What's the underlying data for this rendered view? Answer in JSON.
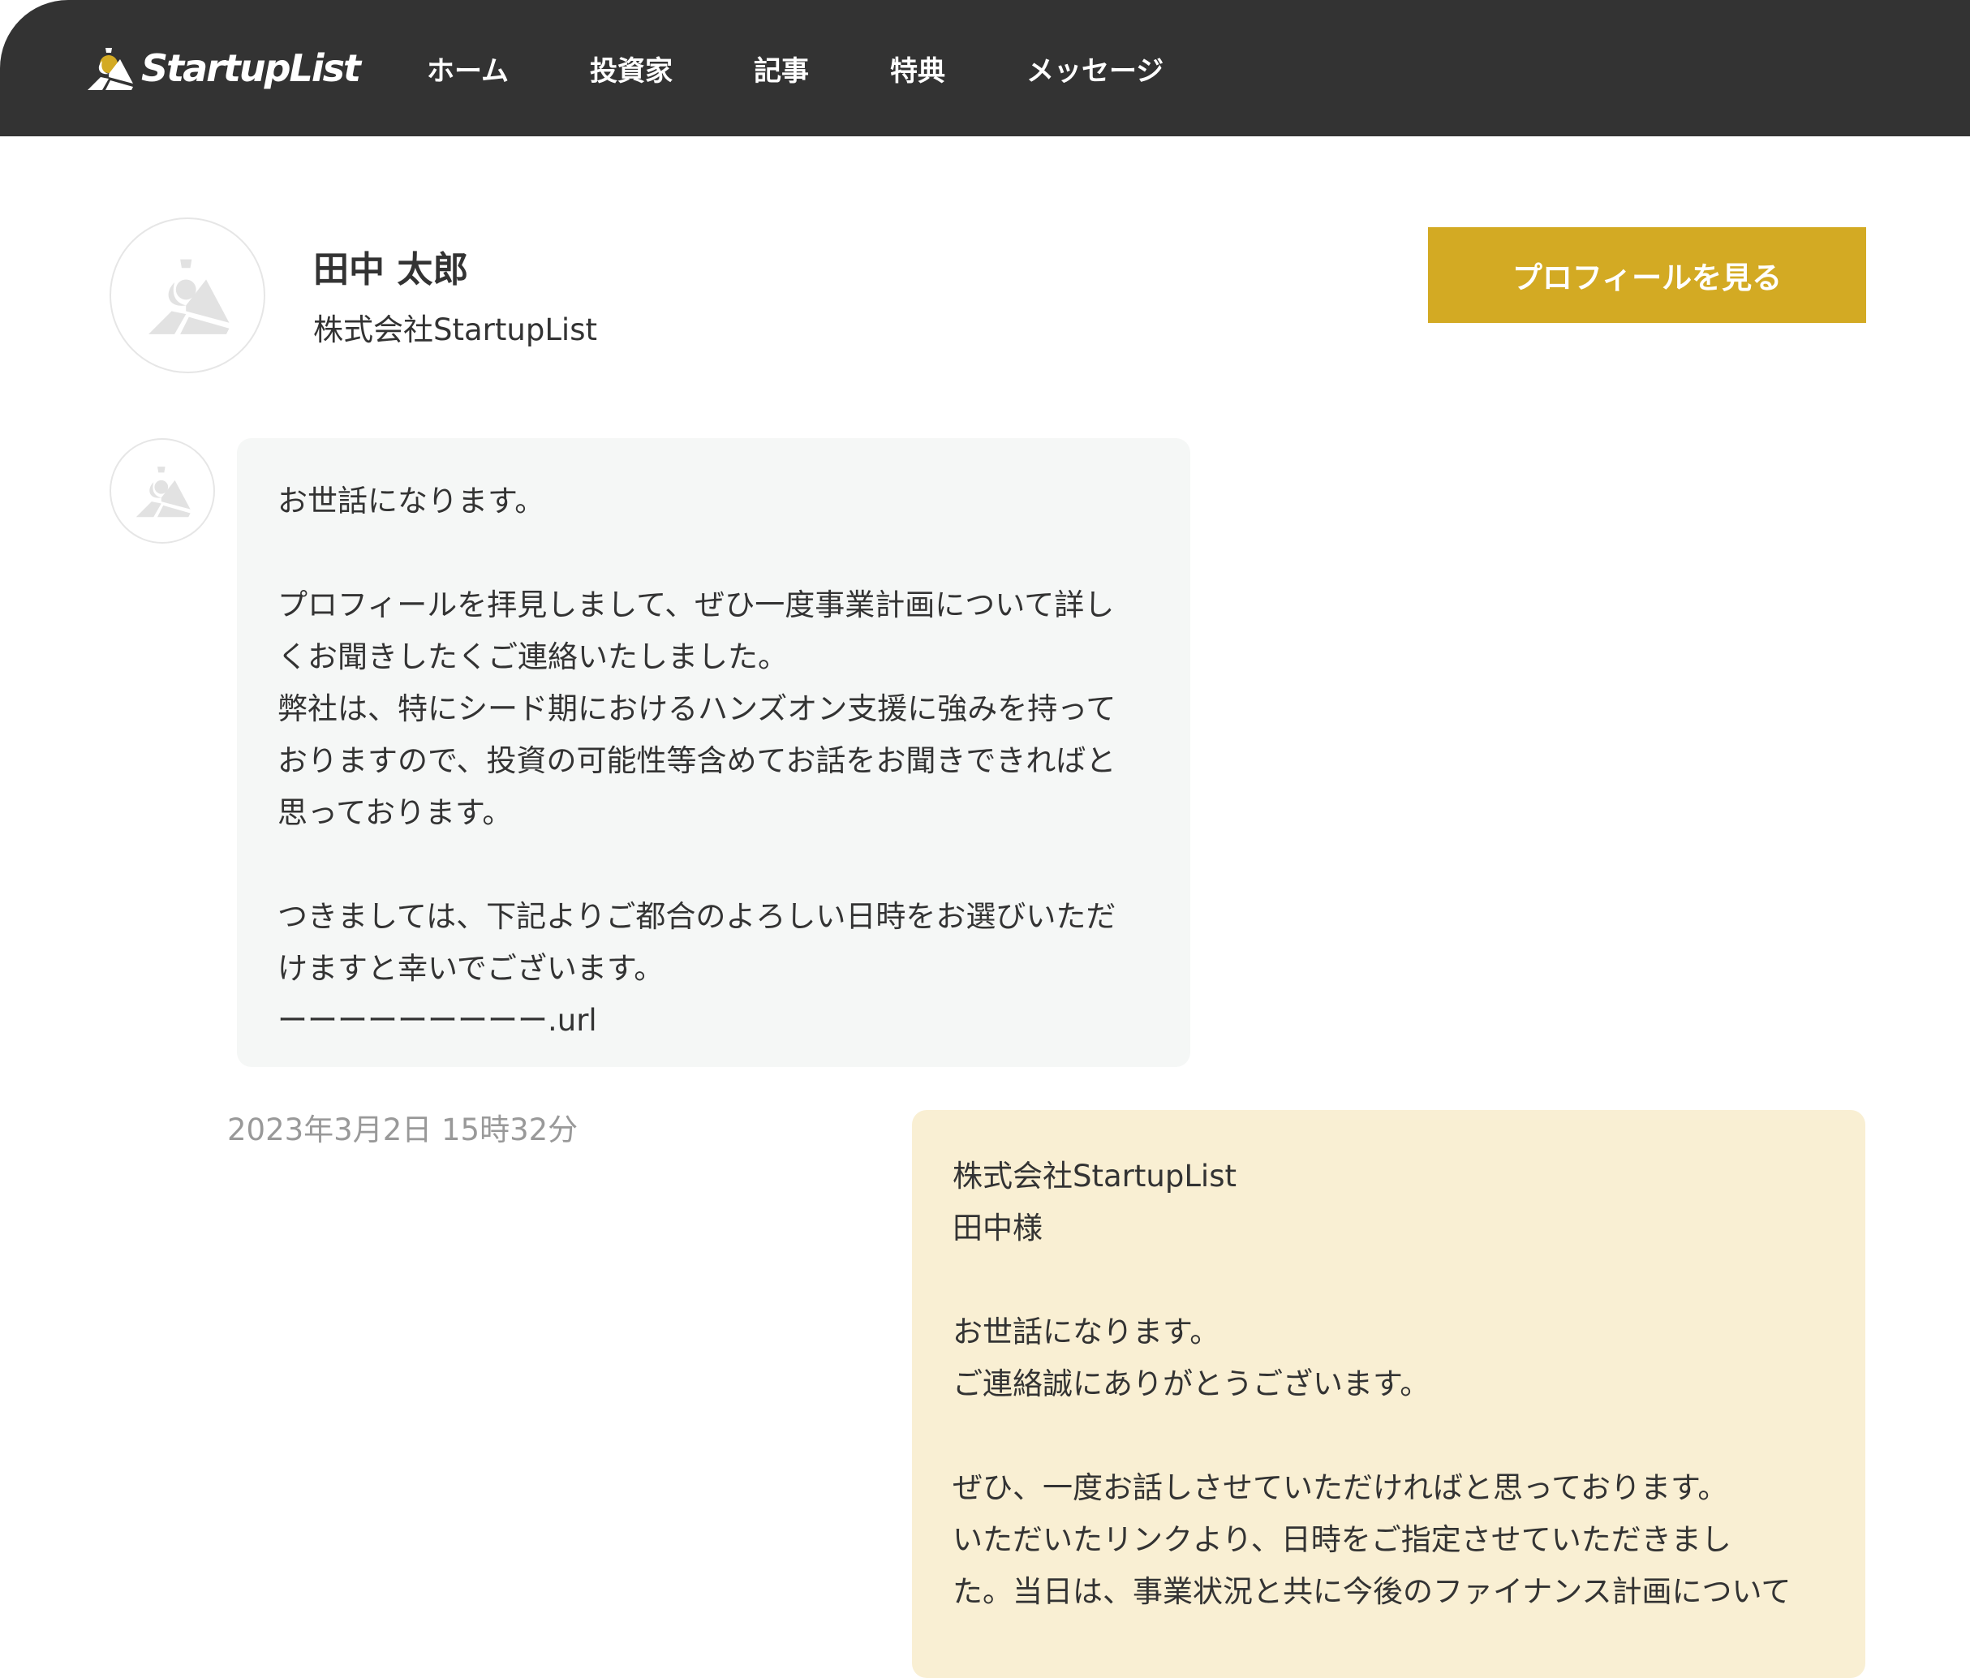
{
  "header": {
    "logo_text": "StartupList",
    "nav": [
      "ホーム",
      "投資家",
      "記事",
      "特典",
      "メッセージ"
    ]
  },
  "profile": {
    "name": "田中 太郎",
    "company": "株式会社StartupList",
    "view_profile_label": "プロフィールを見る",
    "accent_color": "#d3aa23"
  },
  "messages": [
    {
      "direction": "incoming",
      "text": "お世話になります。\n\nプロフィールを拝見しまして、ぜひ一度事業計画について詳し\nくお聞きしたくご連絡いたしました。\n弊社は、特にシード期におけるハンズオン支援に強みを持って\nおりますので、投資の可能性等含めてお話をお聞きできればと\n思っております。\n\nつきましては、下記よりご都合のよろしい日時をお選びいただ\nけますと幸いでございます。\nーーーーーーーーー.url",
      "timestamp": "2023年3月2日 15時32分"
    },
    {
      "direction": "outgoing",
      "text": "株式会社StartupList\n田中様\n\nお世話になります。\nご連絡誠にありがとうございます。\n\nぜひ、一度お話しさせていただければと思っております。\nいただいたリンクより、日時をご指定させていただきまし\nた。当日は、事業状況と共に今後のファイナンス計画について"
    }
  ]
}
